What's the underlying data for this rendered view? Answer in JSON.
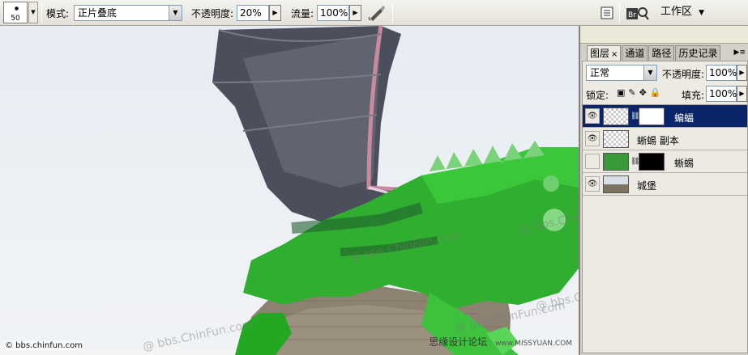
{
  "options_bar": {
    "brush_size": "50",
    "mode_label": "模式:",
    "mode_value": "正片叠底",
    "opacity_label": "不透明度:",
    "opacity_value": "20%",
    "flow_label": "流量:",
    "flow_value": "100%",
    "workspace_label": "工作区",
    "icons": [
      "airbrush-icon",
      "palette-well-icon",
      "bridge-icon"
    ]
  },
  "layers_panel": {
    "tabs": [
      {
        "label": "图层",
        "close": "×"
      },
      {
        "label": "通道"
      },
      {
        "label": "路径"
      },
      {
        "label": "历史记录"
      }
    ],
    "blend_mode": "正常",
    "opacity_label": "不透明度:",
    "opacity_value": "100%",
    "lock_label": "锁定:",
    "fill_label": "填充:",
    "fill_value": "100%",
    "layers": [
      {
        "name": "蝙蝠",
        "visible": true,
        "selected": true,
        "has_mask": true
      },
      {
        "name": "蜥蜴 副本",
        "visible": true,
        "selected": false,
        "has_mask": false
      },
      {
        "name": "蜥蜴",
        "visible": false,
        "selected": false,
        "has_mask": true
      },
      {
        "name": "城堡",
        "visible": true,
        "selected": false,
        "has_mask": false
      }
    ]
  },
  "canvas": {
    "watermark": "@ bbs.ChinFun.com",
    "corner_credit": "© bbs.chinfun.com",
    "site_credit": "思缘设计论坛",
    "site_credit_url": "www.MISSYUAN.COM"
  },
  "colors": {
    "selection": "#0a246a",
    "iguana": "#2fae2f",
    "wing": "#4a4e5a"
  }
}
